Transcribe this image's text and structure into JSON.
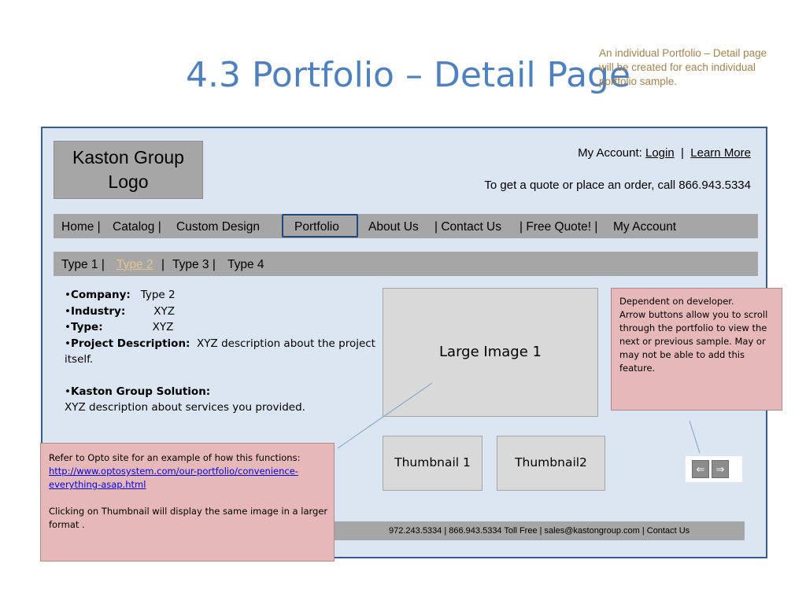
{
  "slide": {
    "title": "4.3 Portfolio – Detail Page",
    "corner_note": "An individual Portfolio – Detail page will be created for each individual portfolio sample."
  },
  "header": {
    "logo_line1": "Kaston Group",
    "logo_line2": "Logo",
    "account_label": "My Account:",
    "login_link": "Login",
    "separator": "|",
    "learn_more_link": "Learn More",
    "quote_text": "To get a quote or place an order, call 866.943.5334"
  },
  "nav": {
    "items": [
      "Home  |",
      "Catalog  |",
      "Custom Design",
      "Portfolio",
      "About Us",
      "|  Contact Us",
      "| Free Quote! |",
      "My Account"
    ]
  },
  "subnav": {
    "items": [
      "Type 1 |",
      "Type 2",
      "|",
      "Type 3 |",
      "Type 4"
    ]
  },
  "details": {
    "company_label": "Company:",
    "company_value": "Type 2",
    "industry_label": "Industry:",
    "industry_value": "XYZ",
    "type_label": "Type:",
    "type_value": "XYZ",
    "description_label": "Project Description:",
    "description_value": "XYZ description about the project itself.",
    "solution_label": "Kaston Group Solution:",
    "solution_value": "XYZ description about services you provided."
  },
  "images": {
    "large": "Large Image 1",
    "thumb1": "Thumbnail  1",
    "thumb2": "Thumbnail2"
  },
  "note_right": {
    "line1": "Dependent on developer.",
    "line2": "Arrow buttons allow you to scroll through the portfolio to view the next  or previous sample. May or may not be able to add this feature."
  },
  "arrows": {
    "prev_icon": "arrow-left-icon",
    "next_icon": "arrow-right-icon"
  },
  "footer": {
    "text": "972.243.5334  | 866.943.5334  Toll Free   |  sales@kastongroup.com   |  Contact Us"
  },
  "note_left": {
    "intro": "Refer to Opto site for an example of how this functions:",
    "link": "http://www.optosystem.com/our-portfolio/convenience-everything-asap.html",
    "outro": "Clicking on Thumbnail will display the same image in a larger format ."
  }
}
